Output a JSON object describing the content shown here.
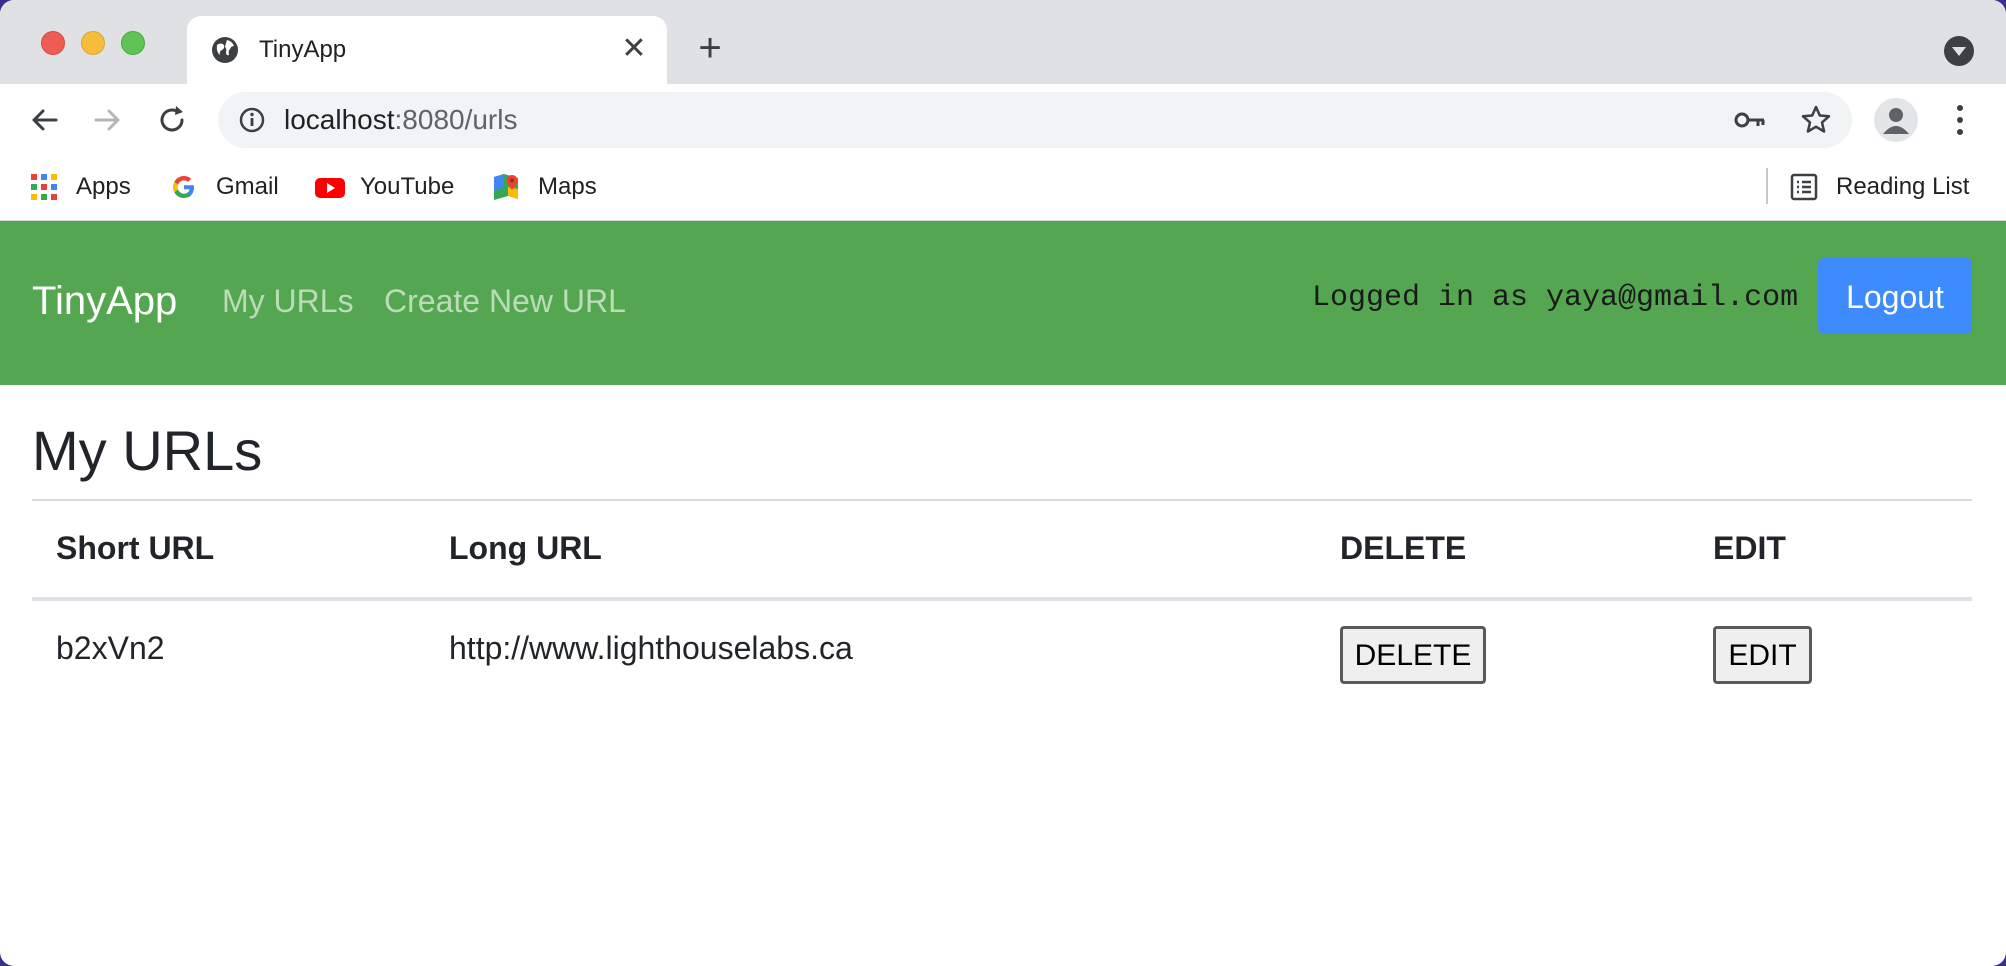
{
  "browser": {
    "tab": {
      "title": "TinyApp",
      "close_symbol": "✕"
    },
    "new_tab_symbol": "+",
    "address": {
      "host": "localhost",
      "rest": ":8080/urls"
    },
    "bookmarks": [
      {
        "label": "Apps",
        "icon": "apps-grid-icon"
      },
      {
        "label": "Gmail",
        "icon": "google-icon"
      },
      {
        "label": "YouTube",
        "icon": "youtube-icon"
      },
      {
        "label": "Maps",
        "icon": "maps-icon"
      }
    ],
    "reading_list": "Reading List"
  },
  "navbar": {
    "brand": "TinyApp",
    "links": [
      "My URLs",
      "Create New URL"
    ],
    "logged_in_text": "Logged in as yaya@gmail.com",
    "logout_label": "Logout",
    "color": "#55a651",
    "logout_color": "#3d8bfd"
  },
  "main": {
    "title": "My URLs",
    "table": {
      "headers": [
        "Short URL",
        "Long URL",
        "DELETE",
        "EDIT"
      ],
      "rows": [
        {
          "short_url": "b2xVn2",
          "long_url": "http://www.lighthouselabs.ca",
          "delete_label": "DELETE",
          "edit_label": "EDIT"
        }
      ]
    }
  }
}
